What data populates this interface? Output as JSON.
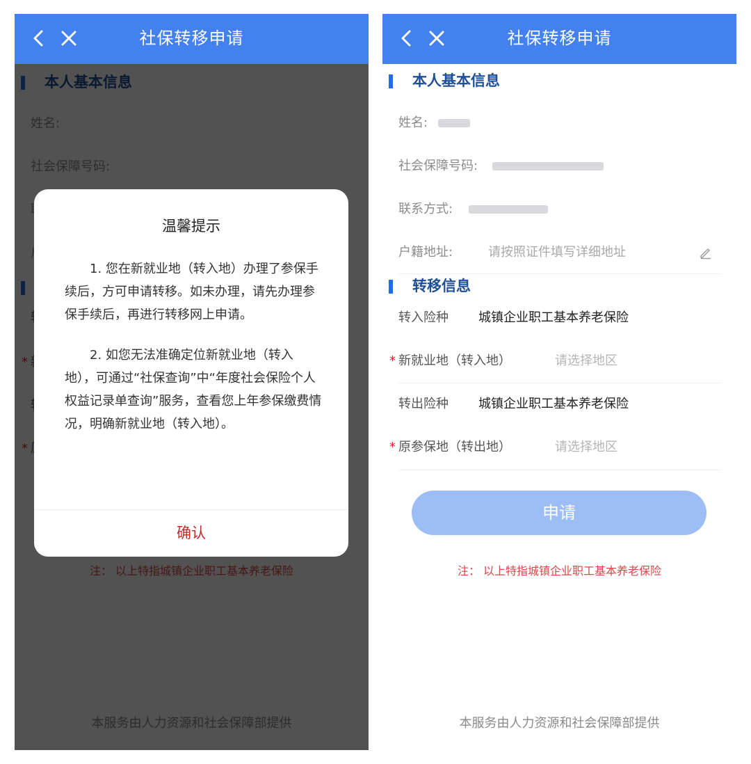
{
  "app": {
    "title": "社保转移申请"
  },
  "basic_info": {
    "section_title": "本人基本信息",
    "name_label": "姓名:",
    "ssn_label": "社会保障号码:",
    "contact_label": "联系方式:",
    "address_label": "户籍地址:",
    "address_placeholder": "请按照证件填写详细地址"
  },
  "transfer_info": {
    "section_title": "转移信息",
    "in_type_label": "转入险种",
    "in_type_value": "城镇企业职工基本养老保险",
    "new_place_label": "新就业地（转入地）",
    "new_place_placeholder": "请选择地区",
    "out_type_label": "转出险种",
    "out_type_value": "城镇企业职工基本养老保险",
    "orig_place_label": "原参保地（转出地）",
    "orig_place_placeholder": "请选择地区",
    "required_mark": "*"
  },
  "apply_button": "申请",
  "note": "注：  以上特指城镇企业职工基本养老保险",
  "footer": "本服务由人力资源和社会保障部提供",
  "dialog": {
    "title": "温馨提示",
    "paragraph1": "1. 您在新就业地（转入地）办理了参保手续后，方可申请转移。如未办理，请先办理参保手续后，再进行转移网上申请。",
    "paragraph2": "2. 如您无法准确定位新就业地（转入地），可通过“社保查询”中“年度社会保险个人权益记录单查询”服务，查看您上年参保缴费情况，明确新就业地（转入地）。",
    "confirm": "确认"
  },
  "icons": {
    "back": "chevron-left-icon",
    "close": "close-icon",
    "edit": "pencil-icon"
  },
  "colors": {
    "app_bar": "#4381ee",
    "section_accent": "#1f6fe0",
    "section_title": "#1f4f96",
    "button": "#9dbdf5",
    "note": "#d54848",
    "confirm": "#c62a2a",
    "required": "#d8262c",
    "overlay": "rgba(0,0,0,0.68)"
  }
}
